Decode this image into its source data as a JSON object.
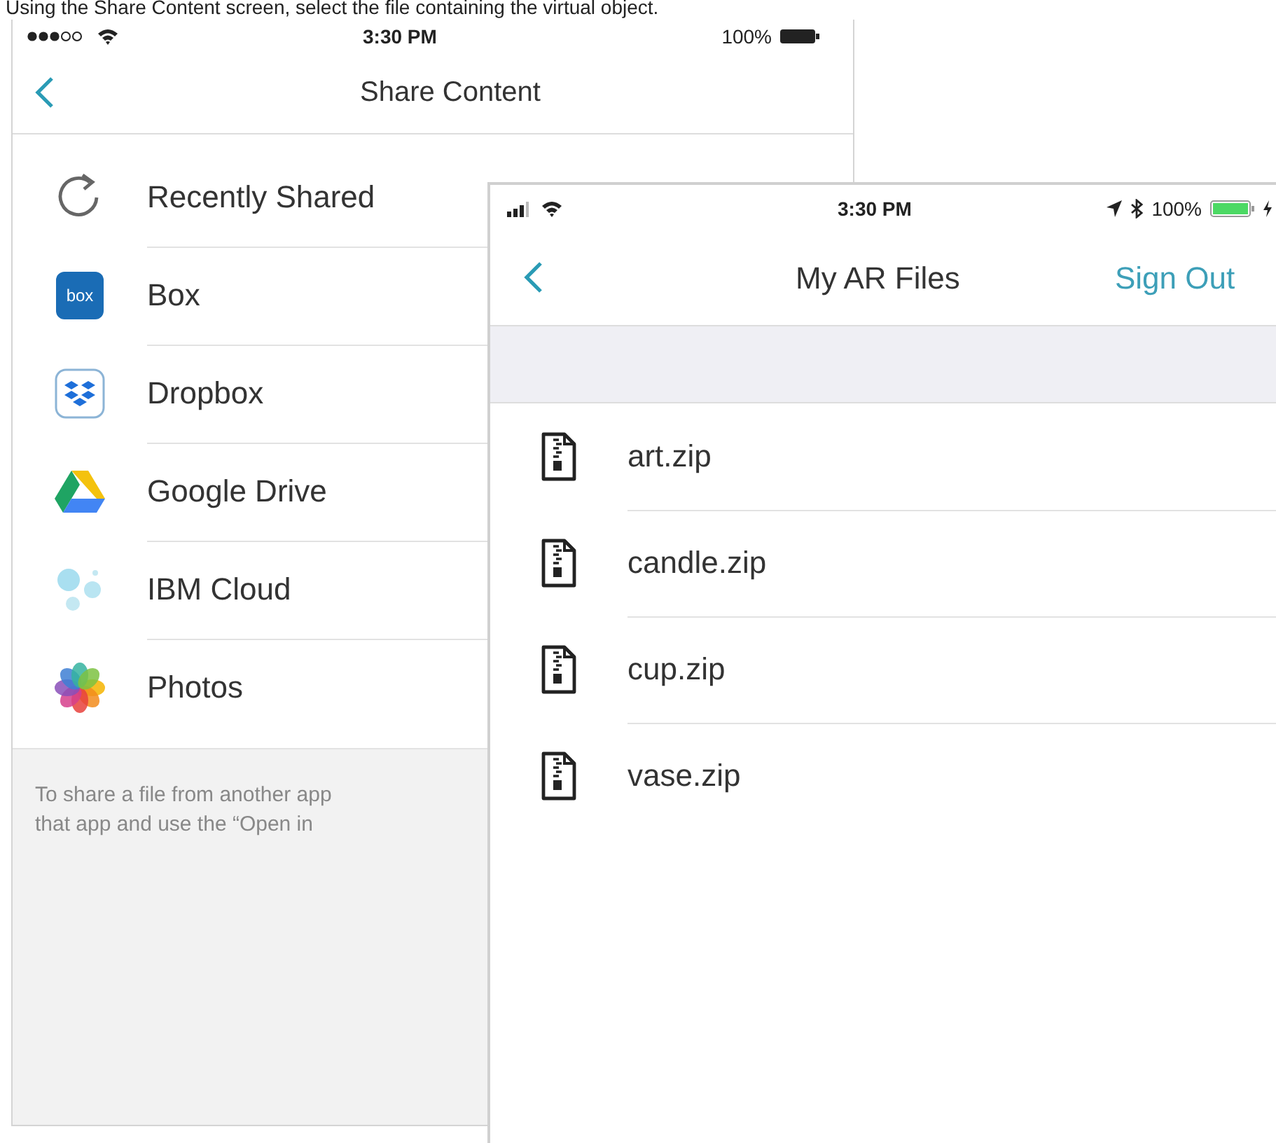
{
  "caption": "Using the Share Content screen, select the file containing the virtual object.",
  "share_screen": {
    "status_bar": {
      "time": "3:30 PM",
      "battery": "100%"
    },
    "title": "Share Content",
    "items": [
      {
        "kind": "recent",
        "label": "Recently Shared"
      },
      {
        "kind": "box",
        "label": "Box",
        "icon_label": "box"
      },
      {
        "kind": "dropbox",
        "label": "Dropbox"
      },
      {
        "kind": "drive",
        "label": "Google Drive"
      },
      {
        "kind": "cloud",
        "label": "IBM Cloud"
      },
      {
        "kind": "photos",
        "label": "Photos"
      }
    ],
    "footer": [
      "To share a file from another app",
      "that app and use the “Open in"
    ]
  },
  "files_screen": {
    "status_bar": {
      "time": "3:30 PM",
      "battery": "100%"
    },
    "title": "My AR Files",
    "action": "Sign Out",
    "files": [
      {
        "name": "art.zip"
      },
      {
        "name": "candle.zip"
      },
      {
        "name": "cup.zip"
      },
      {
        "name": "vase.zip"
      }
    ]
  }
}
